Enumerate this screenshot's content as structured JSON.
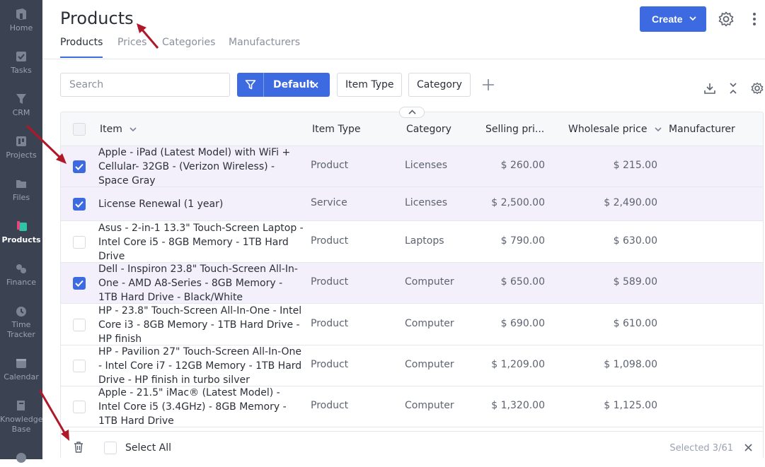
{
  "sidebar": {
    "items": [
      {
        "label": "Home",
        "icon": "home-icon"
      },
      {
        "label": "Tasks",
        "icon": "tasks-icon"
      },
      {
        "label": "CRM",
        "icon": "crm-icon"
      },
      {
        "label": "Projects",
        "icon": "projects-icon"
      },
      {
        "label": "Files",
        "icon": "files-icon"
      },
      {
        "label": "Products",
        "icon": "products-icon",
        "active": true
      },
      {
        "label": "Finance",
        "icon": "finance-icon"
      },
      {
        "label": "Time Tracker",
        "icon": "time-tracker-icon"
      },
      {
        "label": "Calendar",
        "icon": "calendar-icon"
      },
      {
        "label": "Knowledge Base",
        "icon": "knowledge-base-icon"
      }
    ]
  },
  "header": {
    "title": "Products",
    "tabs": [
      "Products",
      "Prices",
      "Categories",
      "Manufacturers"
    ],
    "create_label": "Create"
  },
  "filters": {
    "search_placeholder": "Search",
    "default_label": "Default",
    "item_type_label": "Item Type",
    "category_label": "Category"
  },
  "table": {
    "columns": [
      "Item",
      "Item Type",
      "Category",
      "Selling pri...",
      "Wholesale price",
      "Manufacturer"
    ],
    "rows": [
      {
        "name": "Apple - iPad (Latest Model) with WiFi + Cellular- 32GB - (Verizon Wireless) - Space Gray",
        "type": "Product",
        "category": "Licenses",
        "selling": "$ 260.00",
        "wholesale": "$ 215.00",
        "manufacturer": "",
        "selected": true
      },
      {
        "name": "License Renewal (1 year)",
        "type": "Service",
        "category": "Licenses",
        "selling": "$ 2,500.00",
        "wholesale": "$ 2,490.00",
        "manufacturer": "",
        "selected": true
      },
      {
        "name": "Asus - 2-in-1 13.3\" Touch-Screen Laptop - Intel Core i5 - 8GB Memory - 1TB Hard Drive",
        "type": "Product",
        "category": "Laptops",
        "selling": "$ 790.00",
        "wholesale": "$ 630.00",
        "manufacturer": "",
        "selected": false
      },
      {
        "name": "Dell - Inspiron 23.8\" Touch-Screen All-In-One - AMD A8-Series - 8GB Memory - 1TB Hard Drive - Black/White",
        "type": "Product",
        "category": "Computer",
        "selling": "$ 650.00",
        "wholesale": "$ 589.00",
        "manufacturer": "",
        "selected": true
      },
      {
        "name": "HP - 23.8\" Touch-Screen All-In-One - Intel Core i3 - 8GB Memory - 1TB Hard Drive - HP finish",
        "type": "Product",
        "category": "Computer",
        "selling": "$ 690.00",
        "wholesale": "$ 610.00",
        "manufacturer": "",
        "selected": false
      },
      {
        "name": "HP - Pavilion 27\" Touch-Screen All-In-One - Intel Core i7 - 12GB Memory - 1TB Hard Drive - HP finish in turbo silver",
        "type": "Product",
        "category": "Computer",
        "selling": "$ 1,209.00",
        "wholesale": "$ 1,098.00",
        "manufacturer": "",
        "selected": false
      },
      {
        "name": "Apple - 21.5\" iMac® (Latest Model) - Intel Core i5 (3.4GHz) - 8GB Memory - 1TB Hard Drive",
        "type": "Product",
        "category": "Computer",
        "selling": "$ 1,320.00",
        "wholesale": "$ 1,125.00",
        "manufacturer": "",
        "selected": false
      }
    ]
  },
  "footer": {
    "select_all": "Select All",
    "selected_count": "Selected 3/61"
  },
  "colors": {
    "accent": "#3e6ae1",
    "sidebar_bg": "#3b4352",
    "selected_row": "#f3effb",
    "annotation_arrow": "#b0182a"
  }
}
